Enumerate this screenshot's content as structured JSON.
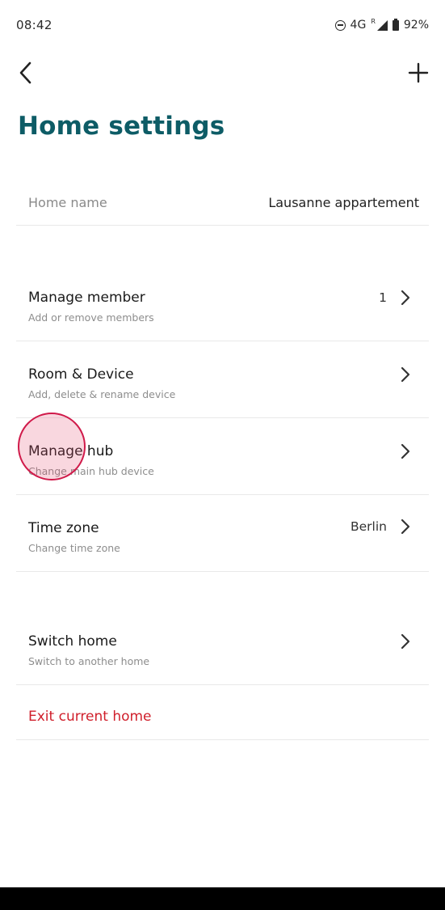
{
  "status_bar": {
    "time": "08:42",
    "network": "4G",
    "roaming": "R",
    "battery": "92%"
  },
  "header": {
    "back_icon": "chevron-left-icon",
    "add_icon": "plus-icon",
    "title": "Home settings"
  },
  "home_name": {
    "label": "Home name",
    "value": "Lausanne appartement"
  },
  "items": [
    {
      "title": "Manage member",
      "subtitle": "Add or remove members",
      "value": "1"
    },
    {
      "title": "Room & Device",
      "subtitle": "Add, delete & rename device",
      "value": ""
    },
    {
      "title": "Manage hub",
      "subtitle": "Change main hub device",
      "value": ""
    },
    {
      "title": "Time zone",
      "subtitle": "Change time zone",
      "value": "Berlin"
    }
  ],
  "switch_home": {
    "title": "Switch home",
    "subtitle": "Switch to another home"
  },
  "exit": {
    "label": "Exit current home"
  },
  "colors": {
    "accent": "#0d5c66",
    "danger": "#d0202c",
    "touch": "#d01a4a"
  }
}
